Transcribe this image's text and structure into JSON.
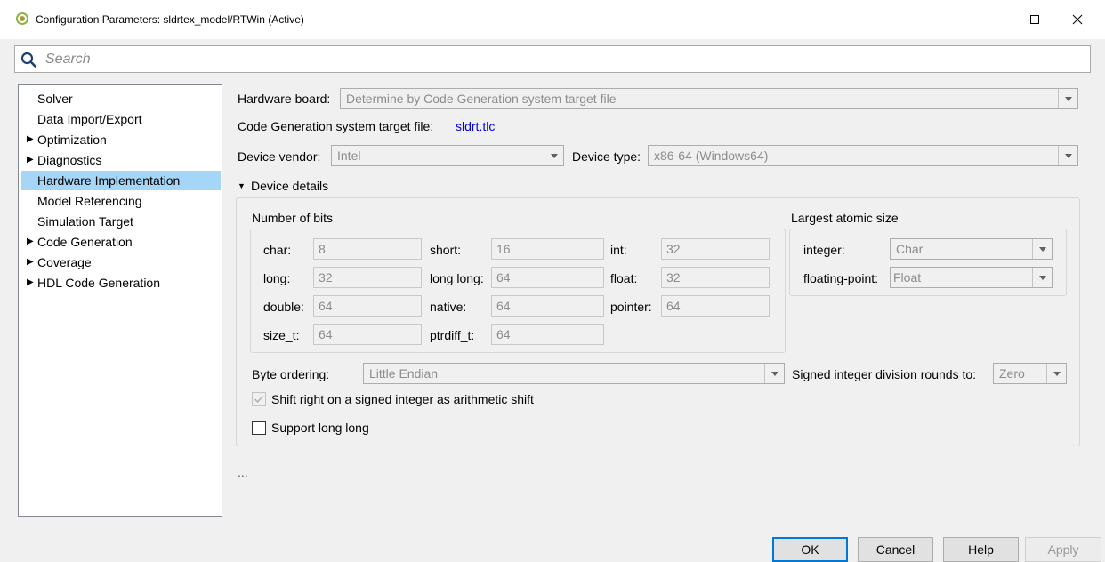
{
  "window": {
    "title": "Configuration Parameters: sldrtex_model/RTWin (Active)",
    "controls": {
      "minimize": "—",
      "maximize": "☐",
      "close": "✕"
    }
  },
  "search": {
    "placeholder": "Search"
  },
  "tree": {
    "items": [
      {
        "label": "Solver",
        "expandable": false
      },
      {
        "label": "Data Import/Export",
        "expandable": false
      },
      {
        "label": "Optimization",
        "expandable": true
      },
      {
        "label": "Diagnostics",
        "expandable": true
      },
      {
        "label": "Hardware Implementation",
        "expandable": false,
        "selected": true
      },
      {
        "label": "Model Referencing",
        "expandable": false
      },
      {
        "label": "Simulation Target",
        "expandable": false
      },
      {
        "label": "Code Generation",
        "expandable": true
      },
      {
        "label": "Coverage",
        "expandable": true
      },
      {
        "label": "HDL Code Generation",
        "expandable": true
      }
    ]
  },
  "hardware": {
    "board_label": "Hardware board:",
    "board_value": "Determine by Code Generation system target file",
    "target_file_label": "Code Generation system target file:",
    "target_file_link": "sldrt.tlc",
    "vendor_label": "Device vendor:",
    "vendor_value": "Intel",
    "type_label": "Device type:",
    "type_value": "x86-64 (Windows64)",
    "details_label": "Device details",
    "bits": {
      "title": "Number of bits",
      "char_label": "char:",
      "char_value": "8",
      "short_label": "short:",
      "short_value": "16",
      "int_label": "int:",
      "int_value": "32",
      "long_label": "long:",
      "long_value": "32",
      "longlong_label": "long long:",
      "longlong_value": "64",
      "float_label": "float:",
      "float_value": "32",
      "double_label": "double:",
      "double_value": "64",
      "native_label": "native:",
      "native_value": "64",
      "pointer_label": "pointer:",
      "pointer_value": "64",
      "sizet_label": "size_t:",
      "sizet_value": "64",
      "ptrdiff_label": "ptrdiff_t:",
      "ptrdiff_value": "64"
    },
    "atomic": {
      "title": "Largest atomic size",
      "integer_label": "integer:",
      "integer_value": "Char",
      "float_label": "floating-point:",
      "float_value": "Float"
    },
    "byte_order_label": "Byte ordering:",
    "byte_order_value": "Little Endian",
    "division_label": "Signed integer division rounds to:",
    "division_value": "Zero",
    "shift_label": "Shift right on a signed integer as arithmetic shift",
    "longlong_label": "Support long long",
    "ellipsis": "..."
  },
  "footer": {
    "ok": "OK",
    "cancel": "Cancel",
    "help": "Help",
    "apply": "Apply"
  },
  "colors": {
    "selection": "#a6d6f7",
    "link": "#0000ee",
    "ok_border": "#0078d7"
  }
}
